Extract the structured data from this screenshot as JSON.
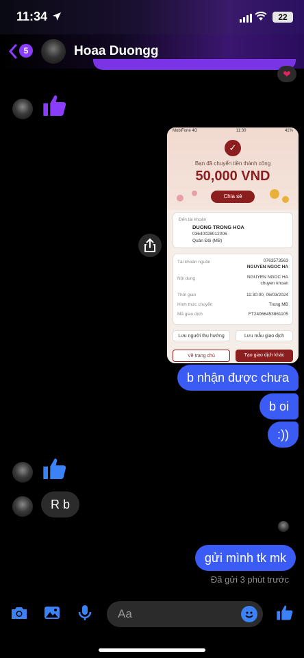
{
  "status_bar": {
    "time": "11:34",
    "battery": "22"
  },
  "header": {
    "back_count": "5",
    "contact_name": "Hoaa Duongg"
  },
  "receipt": {
    "carrier": "MobiFone 4G",
    "time": "11:30",
    "battery": "41%",
    "success_text": "Bạn đã chuyển tiền thành công",
    "amount": "50,000 VND",
    "share_label": "Chia sẻ",
    "to_label": "Đến tài khoản",
    "to_name": "DUONG TRONG HOA",
    "to_account": "03640028012006",
    "to_bank": "Quân Đội (MB)",
    "rows": [
      {
        "label": "Tài khoản nguồn",
        "value": "0763573563",
        "value2": "NGUYEN NGOC HA"
      },
      {
        "label": "Nội dung",
        "value": "NGUYEN NGOC HA",
        "value2": "chuyen khoan"
      },
      {
        "label": "Thời gian",
        "value": "11:30:00, 06/03/2024"
      },
      {
        "label": "Hình thức chuyển",
        "value": "Trong MB"
      },
      {
        "label": "Mã giao dịch",
        "value": "FT24066453861105"
      }
    ],
    "save_beneficiary": "Lưu người thụ hưởng",
    "save_template": "Lưu mẫu giao dịch",
    "home_button": "Về trang chủ",
    "new_txn_button": "Tạo giao dịch khác"
  },
  "messages": {
    "out1": "b nhận được chưa",
    "out2": "b oi",
    "out3": ":))",
    "in1": "R b",
    "out4": "gửi mình tk mk",
    "sent_status": "Đã gửi 3 phút trước"
  },
  "composer": {
    "placeholder": "Aa"
  },
  "colors": {
    "outgoing_bubble": "#3b5bf5",
    "incoming_bubble": "#2b2b2b",
    "accent": "#8a3dff",
    "thumb": "#8a3dff",
    "thumb_blue": "#3b82f6"
  },
  "icons": [
    "location-arrow-icon",
    "signal-icon",
    "wifi-icon",
    "battery-icon",
    "back-chevron-icon",
    "heart-icon",
    "thumbs-up-icon",
    "share-icon",
    "camera-icon",
    "photo-icon",
    "microphone-icon",
    "emoji-icon"
  ]
}
